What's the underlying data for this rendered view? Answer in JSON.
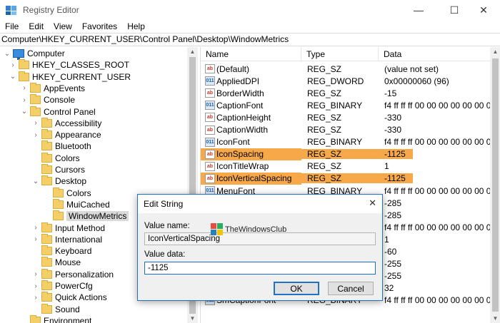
{
  "window": {
    "title": "Registry Editor",
    "minimize_glyph": "—",
    "maximize_glyph": "☐",
    "close_glyph": "✕"
  },
  "menu": [
    "File",
    "Edit",
    "View",
    "Favorites",
    "Help"
  ],
  "address": "Computer\\HKEY_CURRENT_USER\\Control Panel\\Desktop\\WindowMetrics",
  "tree": [
    {
      "label": "Computer",
      "icon": "computer-icon",
      "chevron": "expanded"
    },
    {
      "label": "HKEY_CLASSES_ROOT",
      "icon": "folder-icon",
      "chevron": "collapsed"
    },
    {
      "label": "HKEY_CURRENT_USER",
      "icon": "folder-icon",
      "chevron": "expanded"
    },
    {
      "label": "AppEvents",
      "icon": "folder-icon",
      "chevron": "collapsed"
    },
    {
      "label": "Console",
      "icon": "folder-icon",
      "chevron": "collapsed"
    },
    {
      "label": "Control Panel",
      "icon": "folder-icon",
      "chevron": "expanded"
    },
    {
      "label": "Accessibility",
      "icon": "folder-icon",
      "chevron": "collapsed"
    },
    {
      "label": "Appearance",
      "icon": "folder-icon",
      "chevron": "collapsed"
    },
    {
      "label": "Bluetooth",
      "icon": "folder-icon",
      "chevron": "none"
    },
    {
      "label": "Colors",
      "icon": "folder-icon",
      "chevron": "none"
    },
    {
      "label": "Cursors",
      "icon": "folder-icon",
      "chevron": "none"
    },
    {
      "label": "Desktop",
      "icon": "folder-icon",
      "chevron": "expanded"
    },
    {
      "label": "Colors",
      "icon": "folder-icon",
      "chevron": "none"
    },
    {
      "label": "MuiCached",
      "icon": "folder-icon",
      "chevron": "none"
    },
    {
      "label": "WindowMetrics",
      "icon": "folder-icon",
      "chevron": "none",
      "selected": true
    },
    {
      "label": "Input Method",
      "icon": "folder-icon",
      "chevron": "collapsed"
    },
    {
      "label": "International",
      "icon": "folder-icon",
      "chevron": "collapsed"
    },
    {
      "label": "Keyboard",
      "icon": "folder-icon",
      "chevron": "none"
    },
    {
      "label": "Mouse",
      "icon": "folder-icon",
      "chevron": "none"
    },
    {
      "label": "Personalization",
      "icon": "folder-icon",
      "chevron": "collapsed"
    },
    {
      "label": "PowerCfg",
      "icon": "folder-icon",
      "chevron": "collapsed"
    },
    {
      "label": "Quick Actions",
      "icon": "folder-icon",
      "chevron": "collapsed"
    },
    {
      "label": "Sound",
      "icon": "folder-icon",
      "chevron": "none"
    },
    {
      "label": "Environment",
      "icon": "folder-icon",
      "chevron": "none"
    }
  ],
  "columns": {
    "name": "Name",
    "type": "Type",
    "data": "Data"
  },
  "values": [
    {
      "name": "(Default)",
      "type": "REG_SZ",
      "data": "(value not set)",
      "icon": "string-value-icon"
    },
    {
      "name": "AppliedDPI",
      "type": "REG_DWORD",
      "data": "0x00000060 (96)",
      "icon": "binary-value-icon"
    },
    {
      "name": "BorderWidth",
      "type": "REG_SZ",
      "data": "-15",
      "icon": "string-value-icon"
    },
    {
      "name": "CaptionFont",
      "type": "REG_BINARY",
      "data": "f4 ff ff ff 00 00 00 00 00 00 00 00 00",
      "icon": "binary-value-icon"
    },
    {
      "name": "CaptionHeight",
      "type": "REG_SZ",
      "data": "-330",
      "icon": "string-value-icon"
    },
    {
      "name": "CaptionWidth",
      "type": "REG_SZ",
      "data": "-330",
      "icon": "string-value-icon"
    },
    {
      "name": "IconFont",
      "type": "REG_BINARY",
      "data": "f4 ff ff ff 00 00 00 00 00 00 00 00 00",
      "icon": "binary-value-icon"
    },
    {
      "name": "IconSpacing",
      "type": "REG_SZ",
      "data": "-1125",
      "icon": "string-value-icon",
      "highlight": true
    },
    {
      "name": "IconTitleWrap",
      "type": "REG_SZ",
      "data": "1",
      "icon": "string-value-icon"
    },
    {
      "name": "IconVerticalSpacing",
      "type": "REG_SZ",
      "data": "-1125",
      "icon": "string-value-icon",
      "highlight": true
    },
    {
      "name": "MenuFont",
      "type": "REG_BINARY",
      "data": "f4 ff ff ff 00 00 00 00 00 00 00 00 00",
      "icon": "binary-value-icon"
    },
    {
      "name": "",
      "type": "",
      "data": "-285",
      "icon": ""
    },
    {
      "name": "",
      "type": "",
      "data": "-285",
      "icon": ""
    },
    {
      "name": "",
      "type": "",
      "data": "f4 ff ff ff 00 00 00 00 00 00 00 00 00",
      "icon": ""
    },
    {
      "name": "",
      "type": "",
      "data": "1",
      "icon": ""
    },
    {
      "name": "",
      "type": "",
      "data": "-60",
      "icon": ""
    },
    {
      "name": "",
      "type": "",
      "data": "-255",
      "icon": ""
    },
    {
      "name": "",
      "type": "",
      "data": "-255",
      "icon": ""
    },
    {
      "name": "",
      "type": "",
      "data": "32",
      "icon": ""
    },
    {
      "name": "SmCaptionFont",
      "type": "REG_BINARY",
      "data": "f4 ff ff ff 00 00 00 00 00 00 00 00 00",
      "icon": "binary-value-icon"
    }
  ],
  "dialog": {
    "title": "Edit String",
    "value_name_label": "Value name:",
    "value_name": "IconVerticalSpacing",
    "value_data_label": "Value data:",
    "value_data": "-1125",
    "ok_label": "OK",
    "cancel_label": "Cancel",
    "close_glyph": "✕",
    "watermark": "TheWindowsClub"
  },
  "colors": {
    "highlight": "#f7a94a",
    "accent": "#1e70c8",
    "folder": "#f4cf68"
  }
}
